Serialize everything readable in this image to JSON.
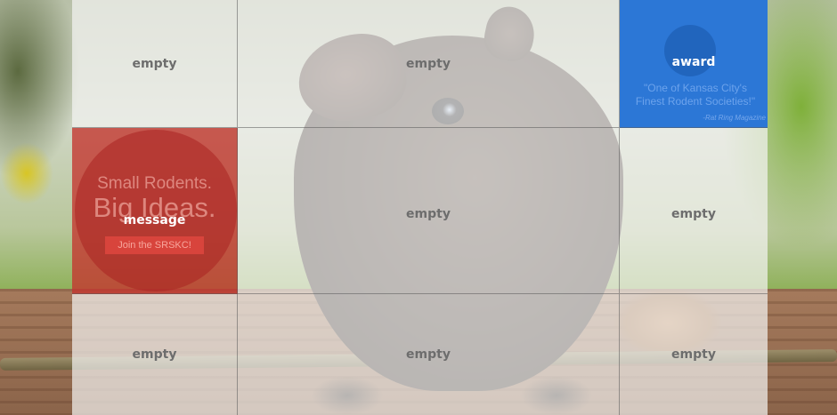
{
  "tiles": {
    "r1c1": {
      "label": "empty"
    },
    "r1c2": {
      "label": "empty"
    },
    "award": {
      "label": "award",
      "quote_line1": "\"One of Kansas City's",
      "quote_line2": "Finest Rodent Societies!\"",
      "credit": "-Rat Ring Magazine"
    },
    "message": {
      "label": "message",
      "headline_line1": "Small Rodents.",
      "headline_line2": "Big Ideas.",
      "cta_button": "Join the SRSKC!"
    },
    "r2c2": {
      "label": "empty"
    },
    "r2c3": {
      "label": "empty"
    },
    "r3c1": {
      "label": "empty"
    },
    "r3c2": {
      "label": "empty"
    },
    "r3c3": {
      "label": "empty"
    }
  },
  "colors": {
    "award_bg": "#2c77d6",
    "message_bg": "#c4342e",
    "tile_label": "#6d6d6d"
  }
}
